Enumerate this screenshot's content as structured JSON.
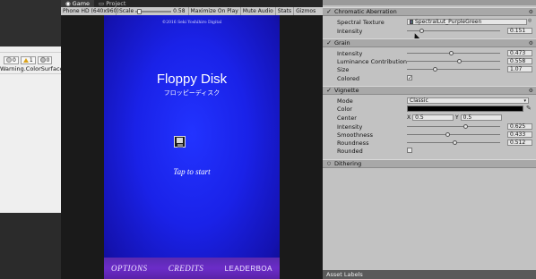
{
  "left_panel": {
    "counters": [
      {
        "icon": "info-icon",
        "count": "0"
      },
      {
        "icon": "warning-icon",
        "count": "1"
      },
      {
        "icon": "error-icon",
        "count": "0"
      }
    ],
    "warning_text": "Warning.ColorSurface"
  },
  "game_view": {
    "tabs": [
      {
        "label": "Game",
        "icon": "game-icon"
      },
      {
        "label": "Project",
        "icon": "folder-icon"
      }
    ],
    "toolbar": {
      "resolution": "Phone HD (640x960)",
      "scale_label": "Scale",
      "scale_value": "0.58",
      "maximize_label": "Maximize On Play",
      "mute_label": "Mute Audio",
      "stats_label": "Stats",
      "gizmos_label": "Gizmos"
    },
    "screen": {
      "copyright": "©2016 Seki Yoshihiro Digital",
      "title": "Floppy Disk",
      "subtitle": "フロッピーディスク",
      "tap_label": "Tap to start",
      "bottom_links": [
        "OPTIONS",
        "CREDITS",
        "LEADERBOA"
      ]
    }
  },
  "inspector": {
    "sections": {
      "chromatic": {
        "title": "Chromatic Aberration",
        "enabled": true,
        "props": {
          "texture_label": "Spectral Texture",
          "texture_value": "SpectralLut_PurpleGreen",
          "intensity_label": "Intensity",
          "intensity_value": "0.151",
          "intensity_fraction": 0.151
        }
      },
      "grain": {
        "title": "Grain",
        "enabled": true,
        "props": {
          "intensity_label": "Intensity",
          "intensity_value": "0.473",
          "intensity_fraction": 0.473,
          "lum_label": "Luminance Contribution",
          "lum_value": "0.558",
          "lum_fraction": 0.558,
          "size_label": "Size",
          "size_value": "1.07",
          "size_fraction": 0.3,
          "colored_label": "Colored",
          "colored_checked": true
        }
      },
      "vignette": {
        "title": "Vignette",
        "enabled": true,
        "props": {
          "mode_label": "Mode",
          "mode_value": "Classic",
          "color_label": "Color",
          "color_value": "#000000",
          "center_label": "Center",
          "center_x_label": "X",
          "center_x_value": "0.5",
          "center_y_label": "Y",
          "center_y_value": "0.5",
          "intensity_label": "Intensity",
          "intensity_value": "0.625",
          "intensity_fraction": 0.625,
          "smooth_label": "Smoothness",
          "smooth_value": "0.433",
          "smooth_fraction": 0.433,
          "round_label": "Roundness",
          "round_value": "0.512",
          "round_fraction": 0.512,
          "rounded_label": "Rounded",
          "rounded_checked": false
        }
      },
      "dithering": {
        "title": "Dithering",
        "enabled": false
      }
    },
    "asset_labels": "Asset Labels"
  },
  "colors": {
    "game_bg": "#1a22e8",
    "bottom_band": "#6b2cc8",
    "inspector_bg": "#c2c2c2"
  }
}
